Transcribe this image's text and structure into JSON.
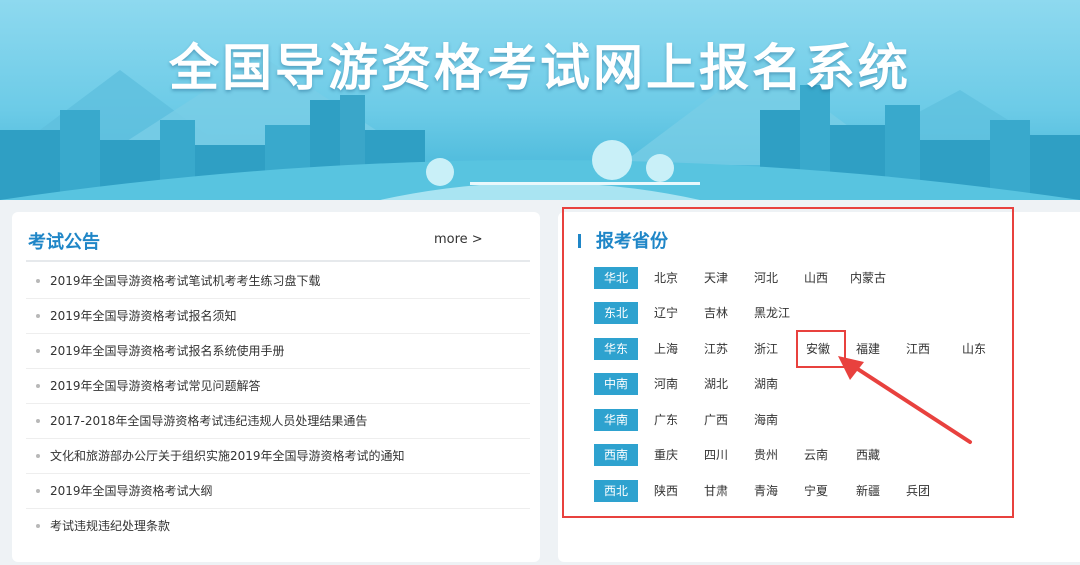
{
  "banner": {
    "title": "全国导游资格考试网上报名系统"
  },
  "notices": {
    "title": "考试公告",
    "more": "more >",
    "items": [
      "2019年全国导游资格考试笔试机考考生练习盘下载",
      "2019年全国导游资格考试报名须知",
      "2019年全国导游资格考试报名系统使用手册",
      "2019年全国导游资格考试常见问题解答",
      "2017-2018年全国导游资格考试违纪违规人员处理结果通告",
      "文化和旅游部办公厅关于组织实施2019年全国导游资格考试的通知",
      "2019年全国导游资格考试大纲",
      "考试违规违纪处理条款"
    ]
  },
  "provinces": {
    "title": "报考省份",
    "regions": [
      {
        "name": "华北",
        "items": [
          "北京",
          "天津",
          "河北",
          "山西",
          "内蒙古"
        ]
      },
      {
        "name": "东北",
        "items": [
          "辽宁",
          "吉林",
          "黑龙江"
        ]
      },
      {
        "name": "华东",
        "items": [
          "上海",
          "江苏",
          "浙江",
          "安徽",
          "福建",
          "江西",
          "山东"
        ]
      },
      {
        "name": "中南",
        "items": [
          "河南",
          "湖北",
          "湖南"
        ]
      },
      {
        "name": "华南",
        "items": [
          "广东",
          "广西",
          "海南"
        ]
      },
      {
        "name": "西南",
        "items": [
          "重庆",
          "四川",
          "贵州",
          "云南",
          "西藏"
        ]
      },
      {
        "name": "西北",
        "items": [
          "陕西",
          "甘肃",
          "青海",
          "宁夏",
          "新疆",
          "兵团"
        ]
      }
    ]
  },
  "colors": {
    "accent": "#1f86c7",
    "badge": "#2ea2cf",
    "annotation": "#e8413e"
  },
  "icons": {
    "arrow": "red-arrow-icon"
  }
}
